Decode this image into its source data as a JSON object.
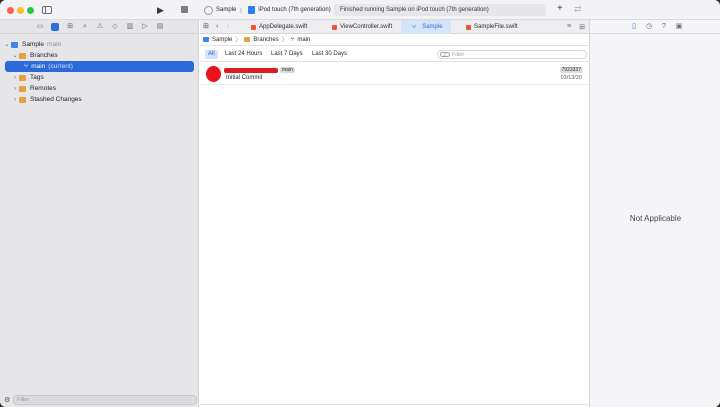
{
  "toolbar": {
    "scheme_name": "Sample",
    "device_name": "iPod touch (7th generation)",
    "status_text": "Finished running Sample on iPod touch (7th generation)"
  },
  "editor_tabs": [
    {
      "label": "AppDelegate.swift"
    },
    {
      "label": "ViewController.swift"
    },
    {
      "label": "Sample"
    },
    {
      "label": "SampleFile.swift"
    }
  ],
  "navigator": {
    "tree": {
      "project": "Sample",
      "project_branch": "main",
      "branches": "Branches",
      "current_branch": "main",
      "current_tag": "(current)",
      "tags": "Tags",
      "remotes": "Remotes",
      "stashed": "Stashed Changes"
    },
    "filter_placeholder": "Filter"
  },
  "jumpbar": {
    "items": [
      "Sample",
      "Branches",
      "main"
    ]
  },
  "ranges": [
    "All",
    "Last 24 Hours",
    "Last 7 Days",
    "Last 30 Days"
  ],
  "search_placeholder": "Filter",
  "commit": {
    "branch_badge": "main",
    "message": "Initial Commit",
    "hash": "7923337",
    "date": "03/13/20"
  },
  "inspector": {
    "empty_text": "Not Applicable"
  },
  "colors": {
    "accent": "#2d6ad9",
    "redaction": "#e11a1f"
  }
}
